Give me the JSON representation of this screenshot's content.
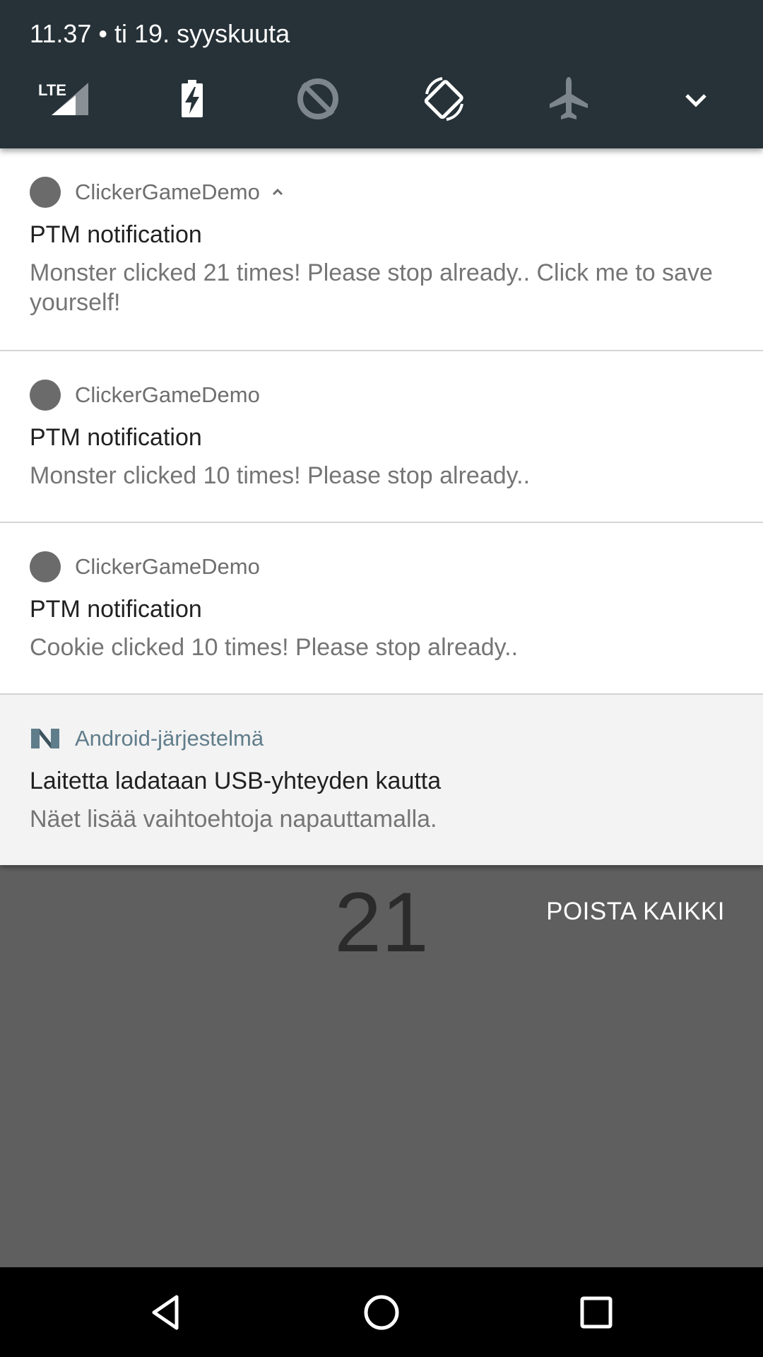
{
  "status": {
    "datetime": "11.37 • ti 19. syyskuuta"
  },
  "quick_settings": {
    "lte_label": "LTE",
    "icons": [
      "signal-lte-icon",
      "battery-charging-icon",
      "data-saver-off-icon",
      "auto-rotate-icon",
      "airplane-mode-icon",
      "expand-chevron-icon"
    ]
  },
  "notifications": [
    {
      "app": "ClickerGameDemo",
      "title": "PTM notification",
      "text": "Monster clicked 21 times! Please stop already.. Click me to save yourself!",
      "expanded": true
    },
    {
      "app": "ClickerGameDemo",
      "title": "PTM notification",
      "text": "Monster clicked 10 times! Please stop already.."
    },
    {
      "app": "ClickerGameDemo",
      "title": "PTM notification",
      "text": "Cookie clicked 10 times! Please stop already.."
    },
    {
      "app": "Android-järjestelmä",
      "title": "Laitetta ladataan USB-yhteyden kautta",
      "text": "Näet lisää vaihtoehtoja napauttamalla."
    }
  ],
  "background": {
    "counter": "21"
  },
  "actions": {
    "clear_all": "POISTA KAIKKI"
  },
  "colors": {
    "header_bg": "#263238",
    "scrim": "#5f5f5f",
    "system_app_accent": "#607d8b"
  }
}
